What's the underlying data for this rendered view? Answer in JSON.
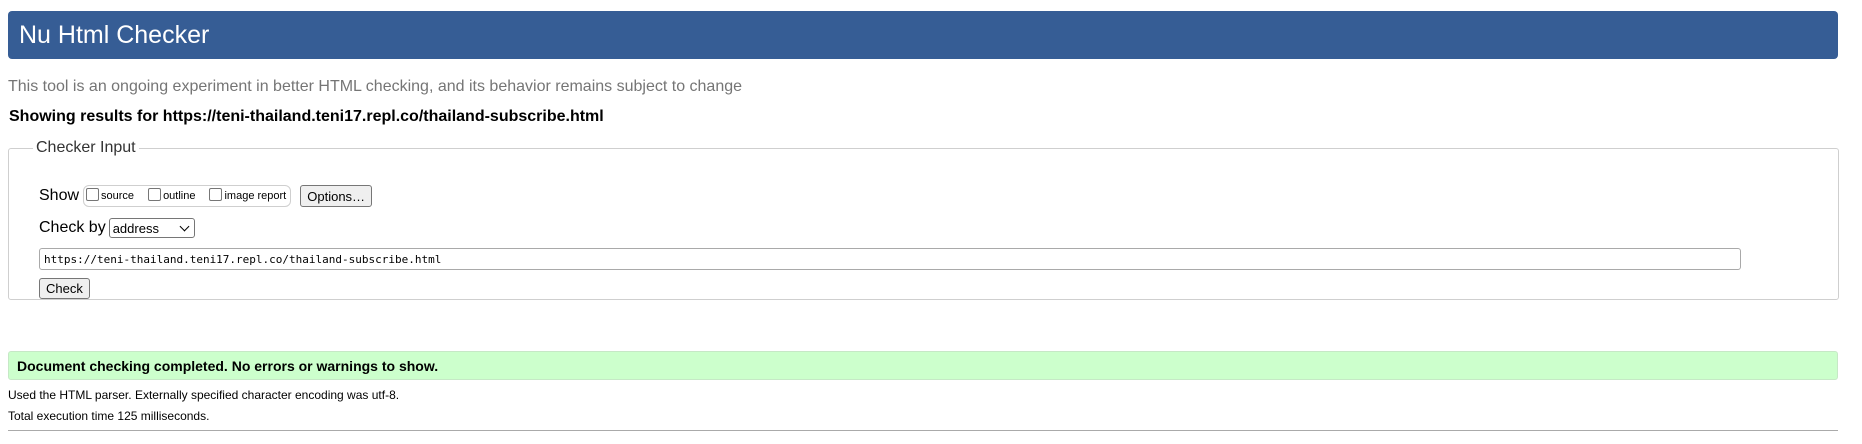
{
  "header": {
    "title": "Nu Html Checker"
  },
  "tagline": "This tool is an ongoing experiment in better HTML checking, and its behavior remains subject to change",
  "results_for": "Showing results for https://teni-thailand.teni17.repl.co/thailand-subscribe.html",
  "checker_input": {
    "legend": "Checker Input",
    "show_label": "Show",
    "show_options": [
      {
        "label": "source",
        "checked": false
      },
      {
        "label": "outline",
        "checked": false
      },
      {
        "label": "image report",
        "checked": false
      }
    ],
    "options_button": "Options…",
    "check_by_label": "Check by",
    "check_by_selected": "address",
    "url_value": "https://teni-thailand.teni17.repl.co/thailand-subscribe.html",
    "check_button": "Check"
  },
  "result": {
    "success_message": "Document checking completed. No errors or warnings to show.",
    "parser_info": "Used the HTML parser. Externally specified character encoding was utf-8.",
    "execution_time": "Total execution time 125 milliseconds."
  },
  "colors": {
    "header_bg": "#365d95",
    "success_bg": "#ccffcc",
    "tagline_text": "#757575"
  }
}
